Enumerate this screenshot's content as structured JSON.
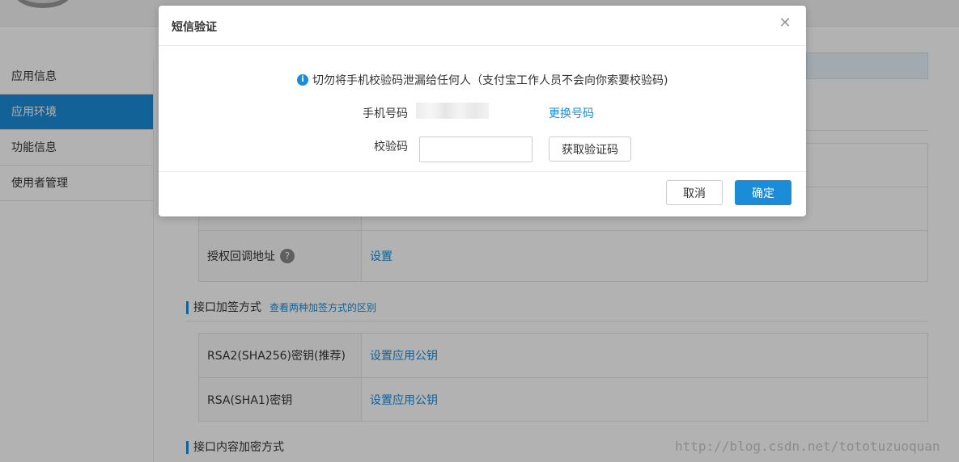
{
  "sidebar": {
    "items": [
      {
        "label": "应用信息"
      },
      {
        "label": "应用环境"
      },
      {
        "label": "功能信息"
      },
      {
        "label": "使用者管理"
      }
    ]
  },
  "main": {
    "auth_callback": {
      "label": "授权回调地址",
      "help": "?",
      "action": "设置"
    },
    "sign_section": {
      "title": "接口加签方式",
      "link": "查看两种加签方式的区别",
      "rows": [
        {
          "label": "RSA2(SHA256)密钥(推荐)",
          "action": "设置应用公钥"
        },
        {
          "label": "RSA(SHA1)密钥",
          "action": "设置应用公钥"
        }
      ]
    },
    "encrypt_section": {
      "title": "接口内容加密方式"
    }
  },
  "watermark": "http://blog.csdn.net/tototuzuoquan",
  "modal": {
    "title": "短信验证",
    "close": "✕",
    "tip_icon": "i",
    "tip": "切勿将手机校验码泄漏给任何人（支付宝工作人员不会向你索要校验码)",
    "phone_label": "手机号码",
    "change_phone": "更换号码",
    "code_label": "校验码",
    "code_value": "",
    "code_placeholder": "",
    "get_code": "获取验证码",
    "cancel": "取消",
    "confirm": "确定"
  },
  "colors": {
    "accent": "#1a8cd8",
    "overlay": "rgba(0,0,0,0.3)"
  }
}
